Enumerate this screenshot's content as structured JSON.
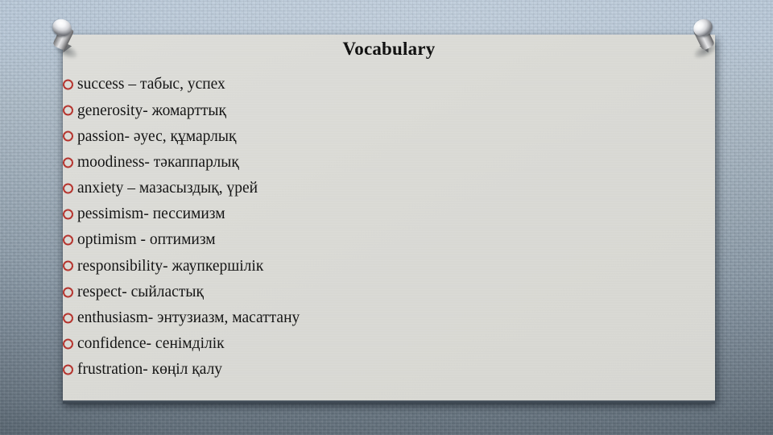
{
  "slide": {
    "title": "Vocabulary",
    "background_color": "#8d9ca8",
    "board_color": "#d9d9d4",
    "bullet_color": "#b4322c",
    "text_color": "#111111"
  },
  "pins": [
    {
      "name": "top-left-pushpin"
    },
    {
      "name": "top-right-pushpin"
    }
  ],
  "vocabulary": [
    {
      "text": "success – табыс, успех"
    },
    {
      "text": "generosity- жомарттық"
    },
    {
      "text": "passion- әуес, құмарлық"
    },
    {
      "text": "moodiness- тәкаппарлық"
    },
    {
      "text": "anxiety – мазасыздық, үрей"
    },
    {
      "text": "pessimism- пессимизм"
    },
    {
      "text": "optimism - оптимизм"
    },
    {
      "text": "responsibility- жаупкершілік"
    },
    {
      "text": "respect- сыйластық"
    },
    {
      "text": "enthusiasm- энтузиазм, масаттану"
    },
    {
      "text": "confidence- сенімділік"
    },
    {
      "text": "frustration- көңіл қалу"
    }
  ]
}
